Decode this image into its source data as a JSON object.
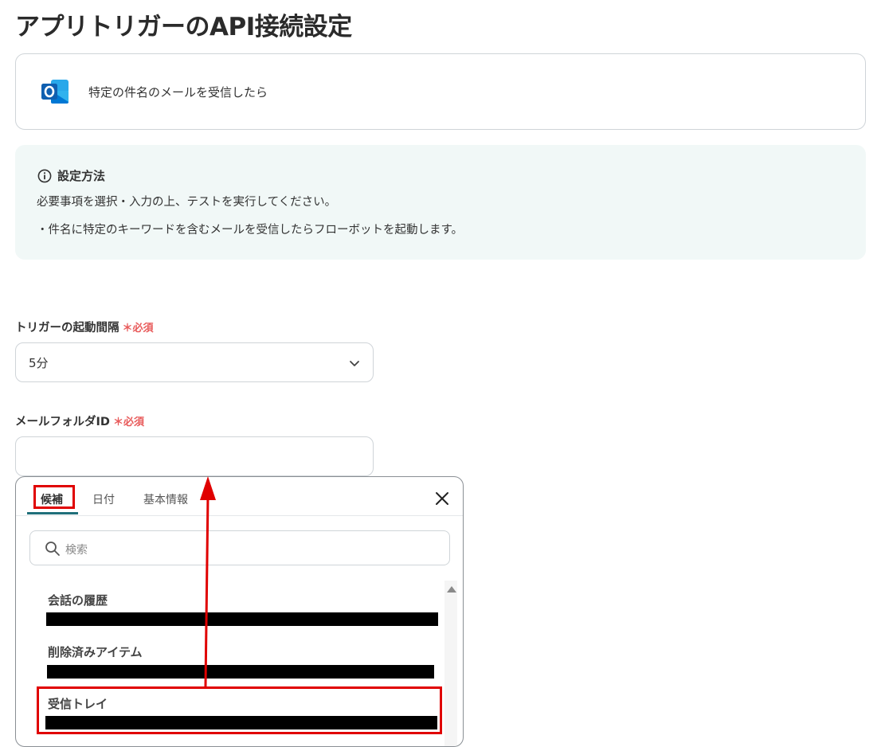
{
  "page": {
    "title": "アプリトリガーのAPI接続設定"
  },
  "trigger": {
    "icon": "outlook-icon",
    "label": "特定の件名のメールを受信したら"
  },
  "info": {
    "title": "設定方法",
    "lines": [
      "必要事項を選択・入力の上、テストを実行してください。",
      "・件名に特定のキーワードを含むメールを受信したらフローボットを起動します。"
    ]
  },
  "fields": {
    "interval": {
      "label": "トリガーの起動間隔",
      "required": "＊必須",
      "value": "5分"
    },
    "folder_id": {
      "label": "メールフォルダID",
      "required": "＊必須",
      "value": ""
    }
  },
  "dropdown": {
    "tabs": [
      "候補",
      "日付",
      "基本情報"
    ],
    "active_tab": "候補",
    "search_placeholder": "検索",
    "options": [
      "会話の履歴",
      "削除済みアイテム",
      "受信トレイ"
    ]
  },
  "annotations": {
    "highlight_color": "#e00000"
  },
  "colors": {
    "accent": "#1f6f7a",
    "required": "#e85a5a",
    "info_bg": "#f1f8f7"
  }
}
